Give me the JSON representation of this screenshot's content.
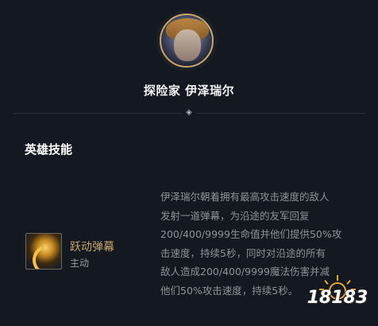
{
  "hero": {
    "name": "探险家 伊泽瑞尔"
  },
  "divider_icon": "diamond-ornament-icon",
  "section": {
    "title": "英雄技能"
  },
  "skill": {
    "name": "跃动弹幕",
    "type": "主动",
    "icon": "barrage-skill-icon",
    "description_lines": [
      "伊泽瑞尔朝着拥有最高攻击速度的敌人",
      "发射一道弹幕，为沿途的友军回复",
      "200/400/9999生命值并他们提供50%攻",
      "击速度，持续5秒，同时对沿途的所有",
      "敌人造成200/400/9999魔法伤害并减",
      "他们50%攻击速度，持续5秒。"
    ]
  },
  "watermark": {
    "text": "18183"
  },
  "colors": {
    "background": "#141821",
    "portrait_border": "#c9a86a",
    "skill_name": "#c8a46a",
    "description": "#8f9097"
  }
}
